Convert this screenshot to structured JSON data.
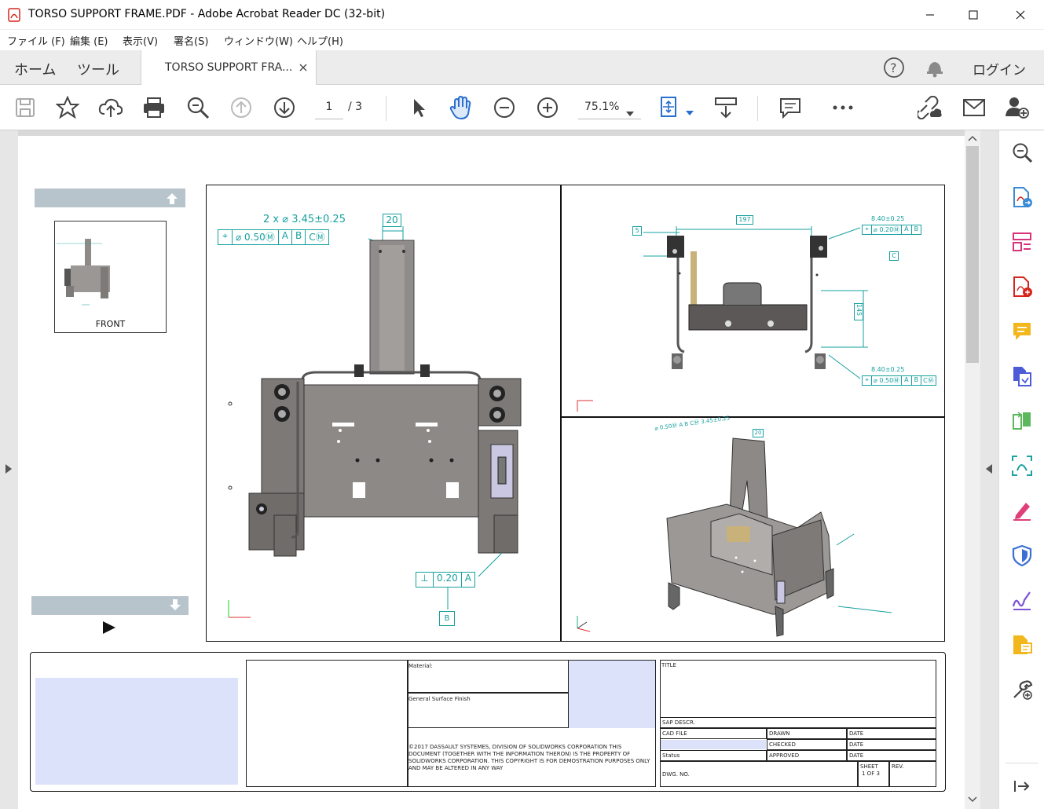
{
  "window": {
    "title": "TORSO SUPPORT FRAME.PDF - Adobe Acrobat Reader DC (32-bit)"
  },
  "menu": [
    "ファイル (F)",
    "編集 (E)",
    "表示(V)",
    "署名(S)",
    "ウィンドウ(W)",
    "ヘルプ(H)"
  ],
  "tabs": {
    "home": "ホーム",
    "tools": "ツール",
    "doc": "TORSO SUPPORT FRA...",
    "login": "ログイン"
  },
  "toolbar": {
    "page_current": "1",
    "page_total": "/ 3",
    "zoom": "75.1%"
  },
  "thumb": {
    "label": "FRONT"
  },
  "views": {
    "front": {
      "dim1": "2 x ⌀ 3.45±0.25",
      "fcf1": [
        "⌀ 0.50Ⓜ",
        "A",
        "B",
        "CⓂ"
      ],
      "dim20": "20",
      "fcf2": [
        "0.20",
        "A"
      ],
      "datum": "B"
    },
    "top": {
      "dim197": "197",
      "dim5": "5",
      "dim145": "145",
      "note1": "8.40±0.25",
      "fcf1": [
        "⌀ 0.20Ⓜ",
        "A",
        "B"
      ],
      "datum": "C",
      "note2": "8.40±0.25",
      "fcf2": [
        "⌀ 0.50Ⓜ",
        "A",
        "B",
        "CⓂ"
      ]
    },
    "iso": {
      "note": "⌀ 0.50Ⓜ A B CⓂ  3.45±0.25",
      "dim20": "20"
    }
  },
  "titleblock": {
    "material": "Material:",
    "finish": "General Surface Finish",
    "copyright": "©2017 DASSAULT SYSTEMES, DIVISION OF SOLIDWORKS CORPORATION THIS DOCUMENT (TOGETHER WITH THE INFORMATION THERON) IS THE PROPERTY OF SOLIDWORKS CORPORATION. THIS COPYRIGHT IS FOR DEMOSTRATION PURPOSES ONLY AND MAY BE ALTERED IN ANY WAY",
    "title": "TITLE",
    "sap": "SAP DESCR.",
    "cad": "CAD FILE",
    "drawn": "DRAWN",
    "date1": "DATE",
    "checked": "CHECKED",
    "date2": "DATE",
    "status": "Status",
    "approved": "APPROVED",
    "date3": "DATE",
    "dwg": "DWG. NO.",
    "sheet": "SHEET",
    "sheet_val": "1 OF 3",
    "rev": "REV."
  }
}
